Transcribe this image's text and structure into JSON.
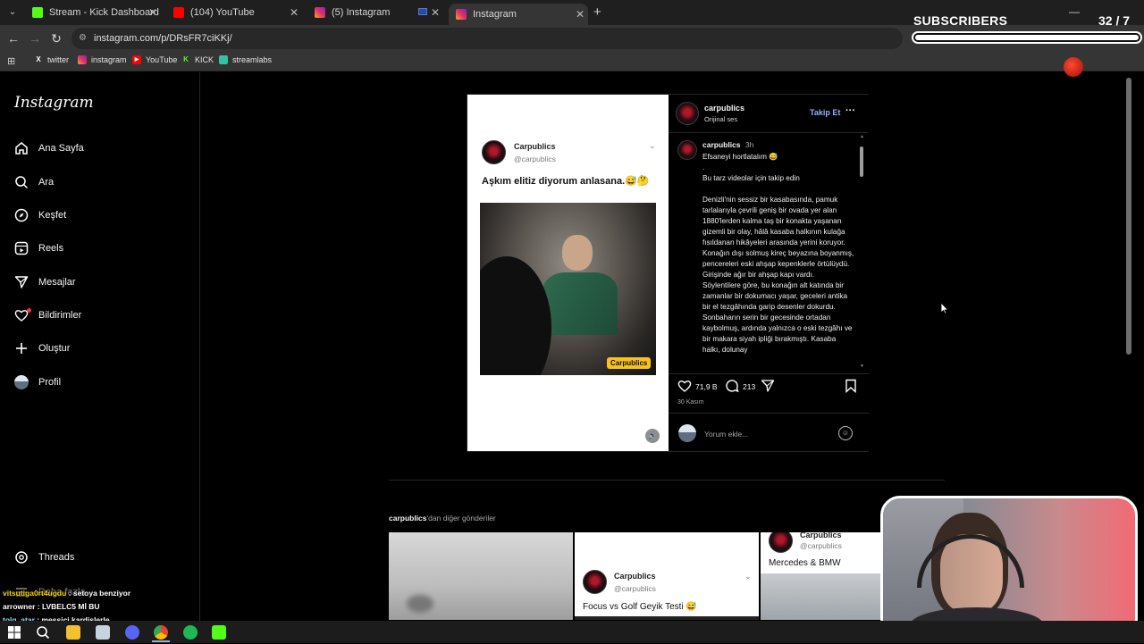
{
  "browser": {
    "tabs": [
      {
        "title": "Stream - Kick Dashboard",
        "color": "#53fc18"
      },
      {
        "title": "(104) YouTube",
        "color": "#ff0000"
      },
      {
        "title": "(5) Instagram",
        "color": "#e1306c"
      },
      {
        "title": "Instagram",
        "color": "#e1306c"
      }
    ],
    "url": "instagram.com/p/DRsFR7ciKKj/",
    "bookmarks": [
      "twitter",
      "instagram",
      "YouTube",
      "KICK",
      "streamlabs"
    ]
  },
  "overlay": {
    "subs_title": "SUBSCRIBERS",
    "subs_count": "32 / 7",
    "subs_progress": 1.0
  },
  "sidebar": {
    "logo": "Instagram",
    "items": [
      {
        "label": "Ana Sayfa",
        "icon": "home-icon"
      },
      {
        "label": "Ara",
        "icon": "search-icon"
      },
      {
        "label": "Keşfet",
        "icon": "compass-icon"
      },
      {
        "label": "Reels",
        "icon": "reels-icon"
      },
      {
        "label": "Mesajlar",
        "icon": "send-icon"
      },
      {
        "label": "Bildirimler",
        "icon": "heart-icon"
      },
      {
        "label": "Oluştur",
        "icon": "plus-icon"
      },
      {
        "label": "Profil",
        "icon": "avatar"
      }
    ],
    "threads": "Threads",
    "more": "Daha fazla"
  },
  "post": {
    "media": {
      "tweet_name": "Carpublics",
      "tweet_handle": "@carpublics",
      "tweet_text": "Aşkım elitiz diyorum anlasana.😅🤔",
      "watermark": "Carpublics"
    },
    "header": {
      "username": "carpublics",
      "audio": "Orijinal ses",
      "follow": "Takip Et",
      "more": "···"
    },
    "caption": {
      "username": "carpublics",
      "time": "3h",
      "text": "Efsaneyi hortlatalım 😅\n.\nBu tarz videolar için takip edin\n\nDenizli'nin sessiz bir kasabasında, pamuk tarlalarıyla çevrili geniş bir ovada yer alan 1880'lerden kalma taş bir konakta yaşanan gizemli bir olay, hâlâ kasaba halkının kulağa fısıldanan hikâyeleri arasında yerini koruyor. Konağın dışı solmuş kireç beyazına boyanmış, pencereleri eski ahşap kepenklerle örtülüydü. Girişinde ağır bir ahşap kapı vardı. Söylentilere göre, bu konağın alt katında bir zamanlar bir dokumacı yaşar, geceleri antika bir el tezgâhında garip desenler dokurdu. Sonbaharın serin bir gecesinde ortadan kaybolmuş, ardında yalnızca o eski tezgâhı ve bir makara siyah ipliği bırakmıştı. Kasaba halkı, dolunay"
    },
    "likes": "71,9 B",
    "comments": "213",
    "date": "30 Kasım",
    "comment_placeholder": "Yorum ekle..."
  },
  "more_posts": {
    "username": "carpublics",
    "suffix": "'dan diğer gönderiler",
    "items": [
      {
        "name": "",
        "handle": "",
        "text": ""
      },
      {
        "name": "Carpublics",
        "handle": "@carpublics",
        "text": "Focus vs Golf Geyik Testi 😅"
      },
      {
        "name": "Carpublics",
        "handle": "@carpublics",
        "text": "Mercedes & BMW"
      }
    ]
  },
  "chat": [
    {
      "user": "vitsutiga0rt4ugdu",
      "message": ": setoya benziyor",
      "color": "#ffd400"
    },
    {
      "user": "arrowner",
      "message": ": LVBELC5 Mİ BU",
      "color": "#ffffff"
    },
    {
      "user": "tolg_atar",
      "message": ": messici kardişlerle",
      "color": "#9ad9ff"
    }
  ],
  "taskbar": [
    "windows-icon",
    "search-icon",
    "file-explorer-icon",
    "app-icon",
    "discord-icon",
    "chrome-icon",
    "spotify-icon",
    "kick-icon"
  ]
}
